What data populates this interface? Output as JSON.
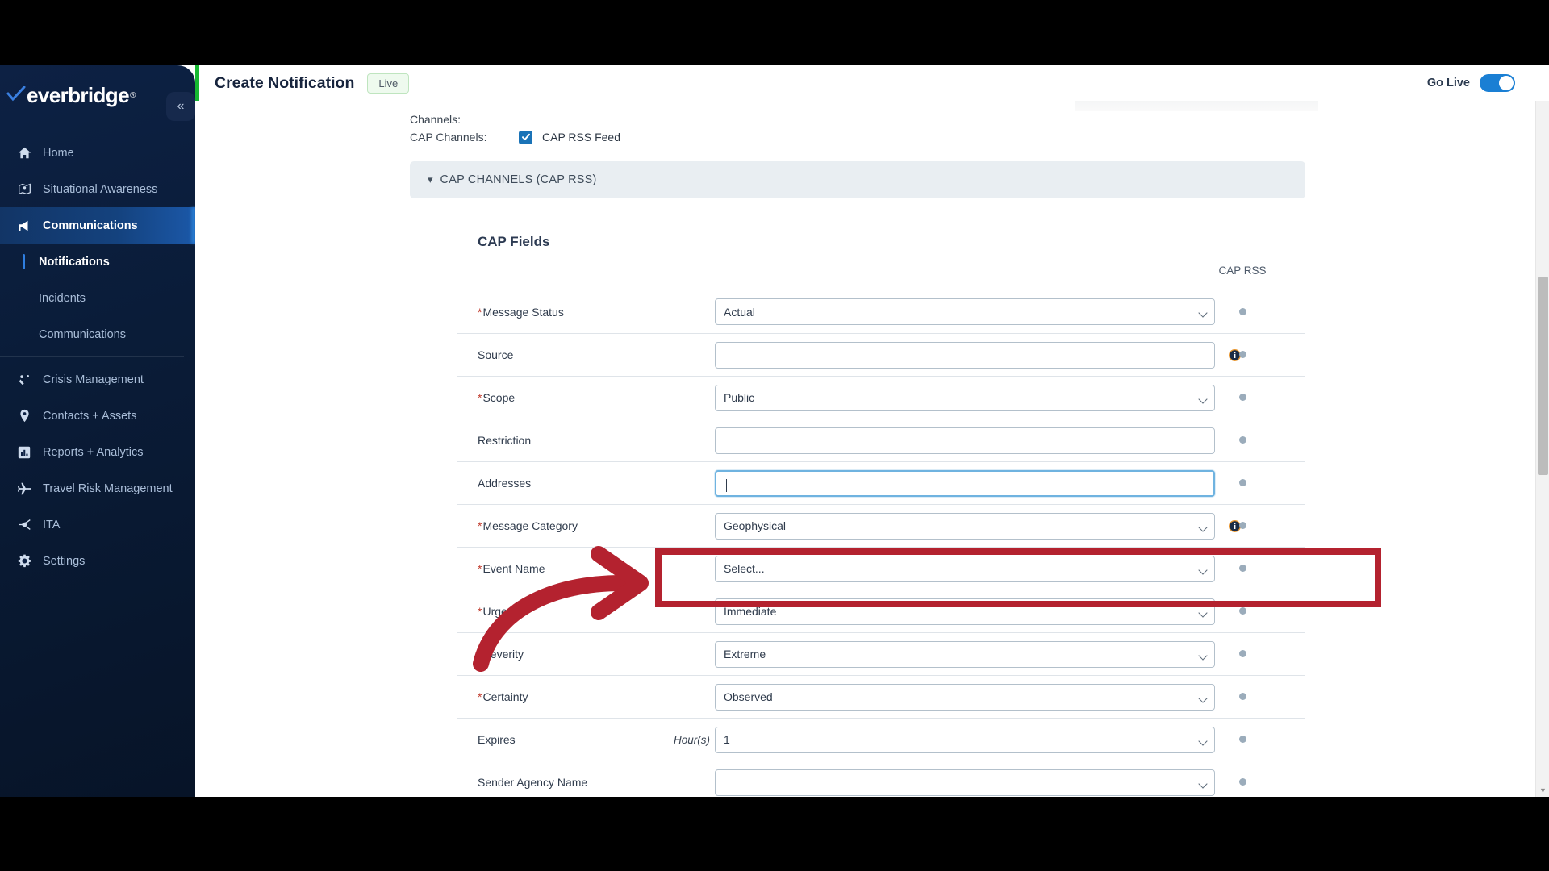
{
  "app": {
    "brand": "everbridge",
    "brand_tm": "®"
  },
  "header": {
    "title": "Create Notification",
    "live_badge": "Live",
    "go_live_label": "Go Live",
    "go_live_on": true,
    "collapse_icon": "«",
    "accent_color": "#16b831",
    "toggle_color": "#1a7fd4"
  },
  "sidebar": {
    "items": [
      {
        "label": "Home",
        "icon": "home-icon",
        "active": false
      },
      {
        "label": "Situational Awareness",
        "icon": "situational-awareness-icon",
        "active": false
      },
      {
        "label": "Communications",
        "icon": "megaphone-icon",
        "active": true
      }
    ],
    "sub_items": [
      {
        "label": "Notifications",
        "selected": true
      },
      {
        "label": "Incidents",
        "selected": false
      },
      {
        "label": "Communications",
        "selected": false
      }
    ],
    "items_bottom": [
      {
        "label": "Crisis Management",
        "icon": "crisis-management-icon"
      },
      {
        "label": "Contacts + Assets",
        "icon": "location-pin-icon"
      },
      {
        "label": "Reports + Analytics",
        "icon": "bar-chart-icon"
      },
      {
        "label": "Travel Risk Management",
        "icon": "airplane-icon"
      },
      {
        "label": "ITA",
        "icon": "ita-icon"
      },
      {
        "label": "Settings",
        "icon": "gear-icon"
      }
    ]
  },
  "channels": {
    "channels_label": "Channels:",
    "cap_channels_label": "CAP Channels:",
    "cap_rss_feed_label": "CAP RSS Feed",
    "cap_rss_feed_checked": true
  },
  "section": {
    "title": "CAP CHANNELS (CAP RSS)",
    "expanded": true,
    "chevron": "⌄"
  },
  "cap_fields": {
    "card_title": "CAP Fields",
    "column_header": "CAP RSS",
    "rows": [
      {
        "label": "Message Status",
        "required": true,
        "type": "select",
        "value": "Actual",
        "info": false,
        "hint": "",
        "rss": true
      },
      {
        "label": "Source",
        "required": false,
        "type": "input",
        "value": "",
        "info": true,
        "hint": "",
        "rss": true
      },
      {
        "label": "Scope",
        "required": true,
        "type": "select",
        "value": "Public",
        "info": false,
        "hint": "",
        "rss": true
      },
      {
        "label": "Restriction",
        "required": false,
        "type": "input",
        "value": "",
        "info": false,
        "hint": "",
        "rss": true
      },
      {
        "label": "Addresses",
        "required": false,
        "type": "input",
        "value": "",
        "info": false,
        "hint": "",
        "rss": true,
        "focused": true
      },
      {
        "label": "Message Category",
        "required": true,
        "type": "select",
        "value": "Geophysical",
        "info": true,
        "hint": "",
        "rss": true
      },
      {
        "label": "Event Name",
        "required": true,
        "type": "select",
        "value": "Select...",
        "info": false,
        "hint": "",
        "rss": true
      },
      {
        "label": "Urgency",
        "required": true,
        "type": "select",
        "value": "Immediate",
        "info": false,
        "hint": "",
        "rss": true
      },
      {
        "label": "Severity",
        "required": true,
        "type": "select",
        "value": "Extreme",
        "info": false,
        "hint": "",
        "rss": true
      },
      {
        "label": "Certainty",
        "required": true,
        "type": "select",
        "value": "Observed",
        "info": false,
        "hint": "",
        "rss": true
      },
      {
        "label": "Expires",
        "required": false,
        "type": "select",
        "value": "1",
        "info": false,
        "hint": "Hour(s)",
        "rss": true
      },
      {
        "label": "Sender Agency Name",
        "required": false,
        "type": "select",
        "value": "",
        "info": false,
        "hint": "",
        "rss": true
      }
    ]
  },
  "annotation": {
    "highlight_color": "#b4222f",
    "target_field": "Addresses"
  }
}
